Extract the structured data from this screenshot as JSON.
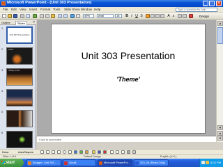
{
  "window": {
    "title": "Microsoft PowerPoint - [Unit 303 Presentation]"
  },
  "menu": {
    "items": [
      "File",
      "Edit",
      "View",
      "Insert",
      "Format",
      "Tools",
      "Slide Show",
      "Window",
      "Help"
    ],
    "help_placeholder": "Type a question for help"
  },
  "toolbar": {
    "zoom": "49%",
    "font": "Arial",
    "font_size": "18",
    "design_label": "Design"
  },
  "outline_tabs": {
    "outline": "Outline",
    "slides": "Slides",
    "close": "×"
  },
  "thumbnails": [
    {
      "num": "1",
      "text": "Unit 303 Presentation",
      "bg": "#ffffff",
      "selected": true
    },
    {
      "num": "2",
      "text": "Author",
      "bg": "#1a1a1a",
      "selected": false
    },
    {
      "num": "3",
      "text": "Holiday Inches",
      "bg": "#5a3a1a",
      "selected": false
    },
    {
      "num": "4",
      "text": "",
      "bg": "#24406a",
      "selected": false
    },
    {
      "num": "5",
      "text": "",
      "bg": "#3a2a1a",
      "selected": false
    },
    {
      "num": "6",
      "text": "",
      "bg": "#111111",
      "selected": false
    }
  ],
  "slide": {
    "title": "Unit 303 Presentation",
    "subtitle": "'Theme'"
  },
  "notes": {
    "placeholder": "Click to add notes"
  },
  "drawbar": {
    "draw": "Draw",
    "autoshapes": "AutoShapes"
  },
  "status": {
    "slide": "Slide 1 of 6",
    "design": "Default Design",
    "language": "English (U.K.)"
  },
  "taskbar": {
    "start": "start",
    "items": [
      {
        "label": "Blogger: Unit 303 - ...",
        "icon_color": "#f08020",
        "active": false
      },
      {
        "label": "Gmail",
        "icon_color": "#d03030",
        "active": false
      },
      {
        "label": "Microsoft PowerPoi...",
        "icon_color": "#d85a1a",
        "active": true
      },
      {
        "label": "303_06 (Read-Only)",
        "icon_color": "#2a5cd6",
        "active": false
      }
    ],
    "clock": "6:02 PM"
  }
}
